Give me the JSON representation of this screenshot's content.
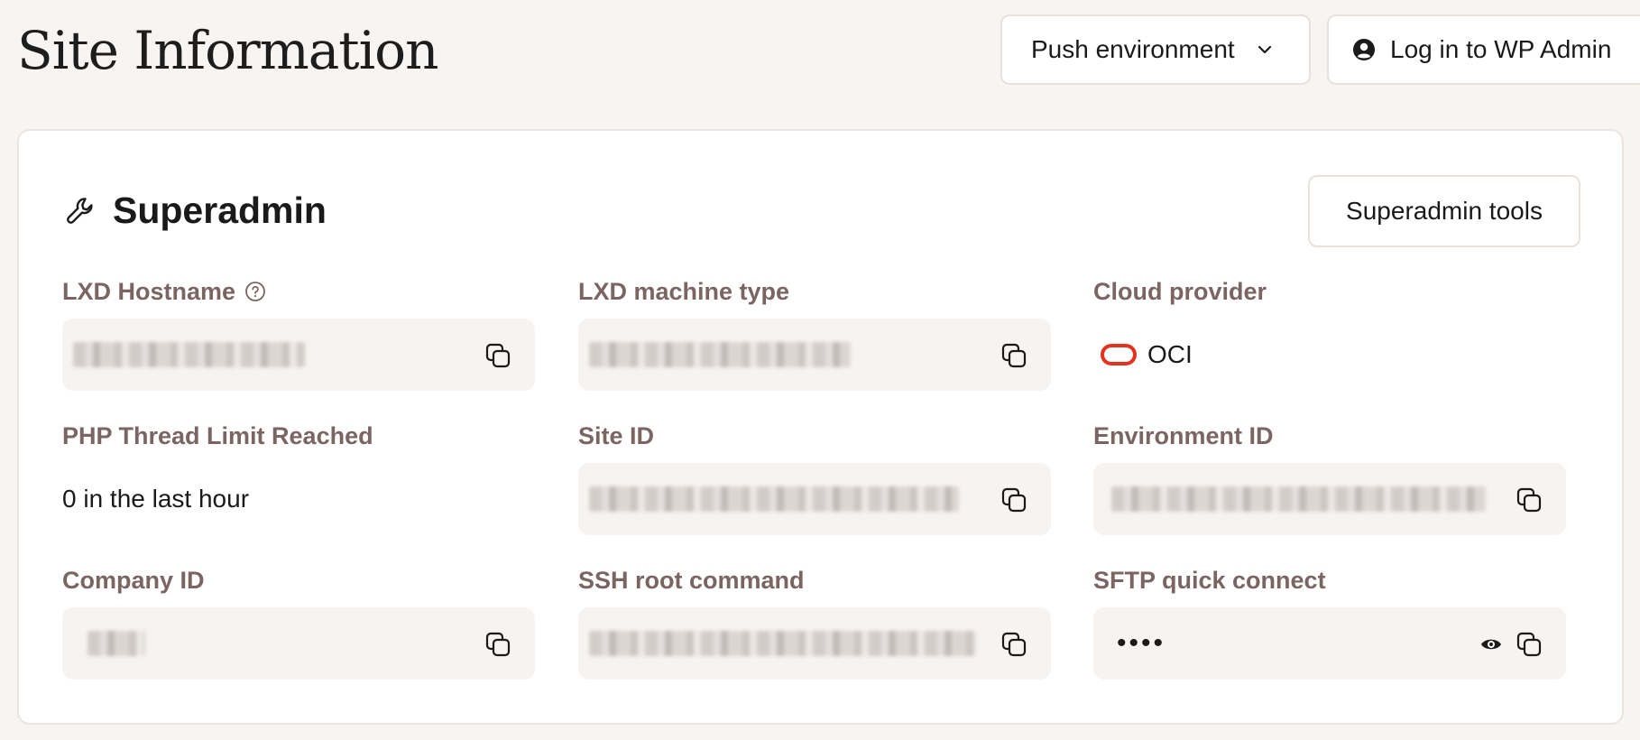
{
  "header": {
    "title": "Site Information",
    "push_label": "Push environment",
    "login_label": "Log in to WP Admin"
  },
  "section": {
    "title": "Superadmin",
    "tools_label": "Superadmin tools"
  },
  "fields": {
    "lxd_hostname": {
      "label": "LXD Hostname"
    },
    "lxd_machine_type": {
      "label": "LXD machine type"
    },
    "cloud_provider": {
      "label": "Cloud provider",
      "value": "OCI"
    },
    "php_thread": {
      "label": "PHP Thread Limit Reached",
      "value": "0 in the last hour"
    },
    "site_id": {
      "label": "Site ID"
    },
    "environment_id": {
      "label": "Environment ID"
    },
    "company_id": {
      "label": "Company ID"
    },
    "ssh_root": {
      "label": "SSH root command"
    },
    "sftp": {
      "label": "SFTP quick connect",
      "masked_value": "••••"
    }
  },
  "icons": {
    "chevron": "chevron-down-icon",
    "user": "user-circle-icon",
    "wrench": "wrench-icon",
    "help": "help-circle-icon",
    "copy": "copy-icon",
    "eye": "eye-icon"
  },
  "colors": {
    "page_bg": "#f7f4f1",
    "label": "#7a6562",
    "field_bg": "#f7f3f0",
    "oci_red": "#e4321f"
  }
}
